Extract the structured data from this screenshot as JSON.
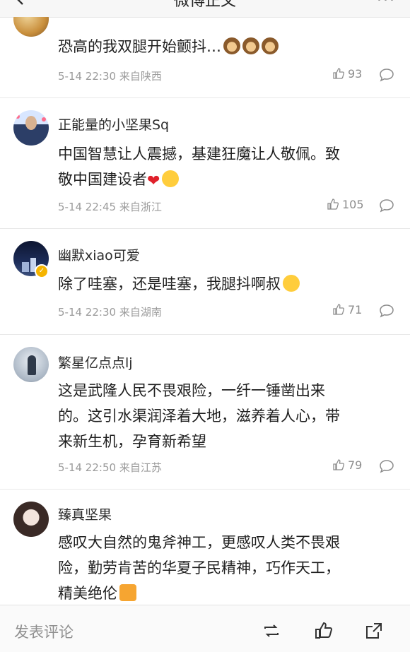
{
  "header": {
    "title": "微博正文",
    "more": "···"
  },
  "comments": [
    {
      "username": "",
      "text": "恐高的我双腿开始颤抖…",
      "emojis": [
        "see-no-evil-monkey",
        "see-no-evil-monkey",
        "see-no-evil-monkey"
      ],
      "time": "5-14 22:30",
      "location": "来自陕西",
      "likes": "93"
    },
    {
      "username": "正能量的小坚果Sq",
      "text_line1": "中国智慧让人震撼，基建狂魔让人敬佩。致",
      "text_line2": "敬中国建设者",
      "emojis": [
        "red-heart",
        "smiling-face-with-hearts"
      ],
      "time": "5-14 22:45",
      "location": "来自浙江",
      "likes": "105"
    },
    {
      "username": "幽默xiao可爱",
      "text": "除了哇塞，还是哇塞，我腿抖啊叔",
      "emojis": [
        "laughing-crying-face"
      ],
      "time": "5-14 22:30",
      "location": "来自湖南",
      "likes": "71",
      "verified": true
    },
    {
      "username": "繁星亿点点lj",
      "text_line1": "这是武隆人民不畏艰险，一纤一锤凿出来",
      "text_line2": "的。这引水渠润泽着大地，滋养着人心，带",
      "text_line3": "来新生机，孕育新希望",
      "time": "5-14 22:50",
      "location": "来自江苏",
      "likes": "79"
    },
    {
      "username": "臻真坚果",
      "text_line1": "感叹大自然的鬼斧神工，更感叹人类不畏艰",
      "text_line2": "险，勤劳肯苦的华夏子民精神，巧作天工，",
      "text_line3": "精美绝伦",
      "emojis": [
        "gift"
      ]
    }
  ],
  "bottom_bar": {
    "comment_placeholder": "发表评论",
    "icons": [
      "repost-icon",
      "like-icon",
      "share-icon"
    ]
  },
  "colors": {
    "meta": "#9b9b9b",
    "text": "#1f1f1f",
    "heart": "#e0212b",
    "verify": "#f5b400"
  }
}
